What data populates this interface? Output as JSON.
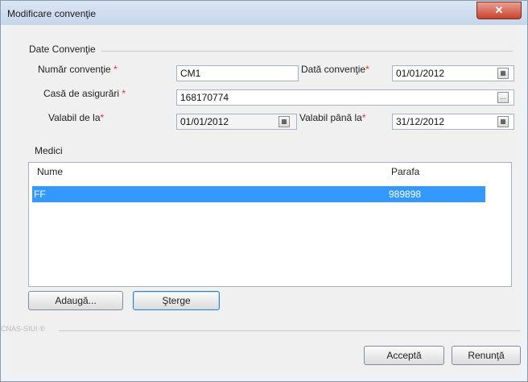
{
  "window": {
    "title": "Modificare convenţie",
    "close_glyph": "✕"
  },
  "date_conventie": {
    "section_title": "Date Convenţie",
    "numar": {
      "label": "Număr convenţie",
      "value": "CM1"
    },
    "data": {
      "label": "Dată convenţie",
      "value": "01/01/2012"
    },
    "casa": {
      "label": "Casă de asigurări",
      "value": "168170774"
    },
    "valabil_de_la": {
      "label": "Valabil de la",
      "value": "01/01/2012"
    },
    "valabil_pana_la": {
      "label": "Valabil până la",
      "value": "31/12/2012"
    },
    "required_mark": "*"
  },
  "medici": {
    "section_title": "Medici",
    "columns": [
      "Nume",
      "Parafa"
    ],
    "rows": [
      {
        "nume": "FF",
        "parafa": "989898"
      }
    ],
    "add_label": "Adaugă...",
    "delete_label": "Şterge"
  },
  "footer": {
    "watermark": "CNAS-SIUI ®",
    "accept_label": "Acceptă",
    "cancel_label": "Renunţă"
  },
  "icons": {
    "calendar": "calendar-icon",
    "ellipsis": "ellipsis-icon"
  }
}
